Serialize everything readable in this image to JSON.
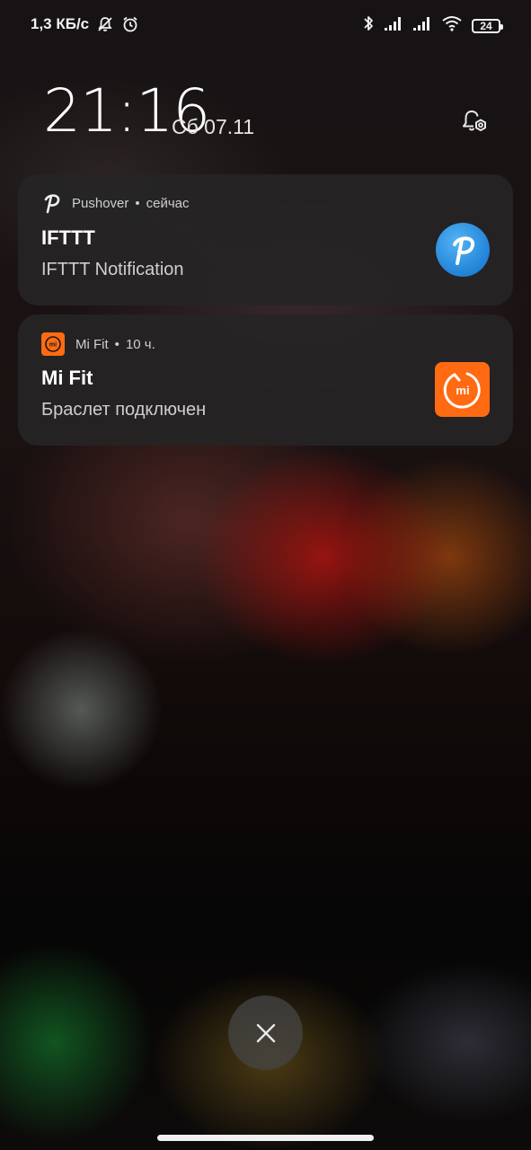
{
  "status_bar": {
    "network_speed": "1,3 КБ/с",
    "left_icons": [
      "notifications-off-icon",
      "alarm-icon"
    ],
    "right_icons": [
      "bluetooth-icon",
      "signal-1-icon",
      "signal-2-icon",
      "wifi-icon"
    ],
    "battery_level": "24"
  },
  "lockscreen": {
    "time": "21:16",
    "date": "Сб 07.11",
    "settings_icon": "notification-settings-icon"
  },
  "notifications": [
    {
      "app": "Pushover",
      "time": "сейчас",
      "title": "IFTTT",
      "text": "IFTTT Notification",
      "app_icon": "pushover-icon",
      "accent": "#2b8ee6"
    },
    {
      "app": "Mi Fit",
      "time": "10 ч.",
      "title": "Mi Fit",
      "text": "Браслет подключен",
      "app_icon": "mi-fit-icon",
      "accent": "#ff6a12"
    }
  ],
  "separator": "•",
  "dismiss": {
    "icon": "close-icon"
  }
}
